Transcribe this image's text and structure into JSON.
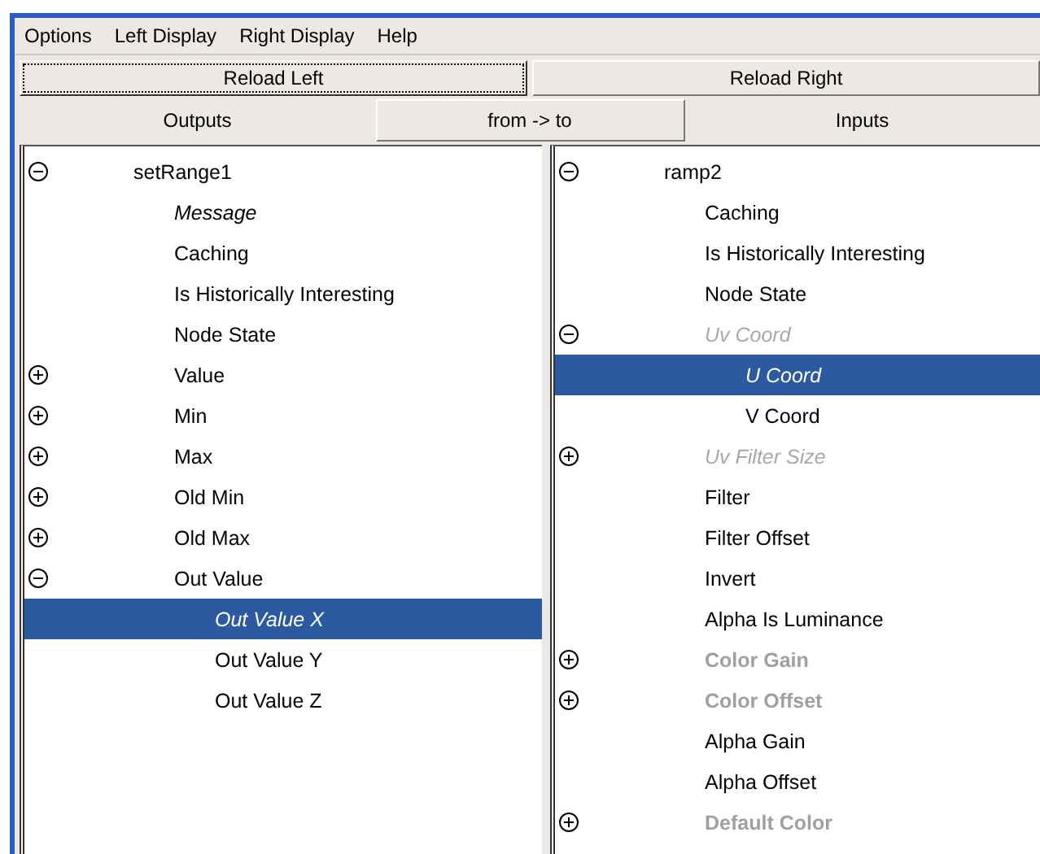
{
  "menu": [
    "Options",
    "Left Display",
    "Right Display",
    "Help"
  ],
  "reload_buttons": [
    {
      "label": "Reload Left",
      "focused": true
    },
    {
      "label": "Reload Right",
      "focused": false
    }
  ],
  "header": {
    "left_label": "Outputs",
    "direction_button": "from -> to",
    "right_label": "Inputs"
  },
  "left_tree": [
    {
      "label": "setRange1",
      "kind": "plain",
      "expanded": true,
      "selected": false,
      "children": [
        {
          "label": "Message",
          "kind": "italic",
          "selected": false
        },
        {
          "label": "Caching",
          "kind": "plain",
          "selected": false
        },
        {
          "label": "Is Historically Interesting",
          "kind": "plain",
          "selected": false
        },
        {
          "label": "Node State",
          "kind": "plain",
          "selected": false
        },
        {
          "label": "Value",
          "kind": "plain",
          "expanded": false,
          "selected": false
        },
        {
          "label": "Min",
          "kind": "plain",
          "expanded": false,
          "selected": false
        },
        {
          "label": "Max",
          "kind": "plain",
          "expanded": false,
          "selected": false
        },
        {
          "label": "Old Min",
          "kind": "plain",
          "expanded": false,
          "selected": false
        },
        {
          "label": "Old Max",
          "kind": "plain",
          "expanded": false,
          "selected": false
        },
        {
          "label": "Out Value",
          "kind": "plain",
          "expanded": true,
          "selected": false,
          "children": [
            {
              "label": "Out Value X",
              "kind": "italic",
              "selected": true
            },
            {
              "label": "Out Value Y",
              "kind": "plain",
              "selected": false
            },
            {
              "label": "Out Value Z",
              "kind": "plain",
              "selected": false
            }
          ]
        }
      ]
    }
  ],
  "right_tree": [
    {
      "label": "ramp2",
      "kind": "plain",
      "expanded": true,
      "selected": false,
      "children": [
        {
          "label": "Caching",
          "kind": "plain",
          "selected": false
        },
        {
          "label": "Is Historically Interesting",
          "kind": "plain",
          "selected": false
        },
        {
          "label": "Node State",
          "kind": "plain",
          "selected": false
        },
        {
          "label": "Uv Coord",
          "kind": "dim_italic",
          "expanded": true,
          "selected": false,
          "children": [
            {
              "label": "U Coord",
              "kind": "italic",
              "selected": true
            },
            {
              "label": "V Coord",
              "kind": "plain",
              "selected": false
            }
          ]
        },
        {
          "label": "Uv Filter Size",
          "kind": "dim_italic",
          "expanded": false,
          "selected": false
        },
        {
          "label": "Filter",
          "kind": "plain",
          "selected": false
        },
        {
          "label": "Filter Offset",
          "kind": "plain",
          "selected": false
        },
        {
          "label": "Invert",
          "kind": "plain",
          "selected": false
        },
        {
          "label": "Alpha Is Luminance",
          "kind": "plain",
          "selected": false
        },
        {
          "label": "Color Gain",
          "kind": "dim_bold",
          "expanded": false,
          "selected": false
        },
        {
          "label": "Color Offset",
          "kind": "dim_bold",
          "expanded": false,
          "selected": false
        },
        {
          "label": "Alpha Gain",
          "kind": "plain",
          "selected": false
        },
        {
          "label": "Alpha Offset",
          "kind": "plain",
          "selected": false
        },
        {
          "label": "Default Color",
          "kind": "dim_bold",
          "expanded": false,
          "selected": false
        }
      ]
    }
  ]
}
